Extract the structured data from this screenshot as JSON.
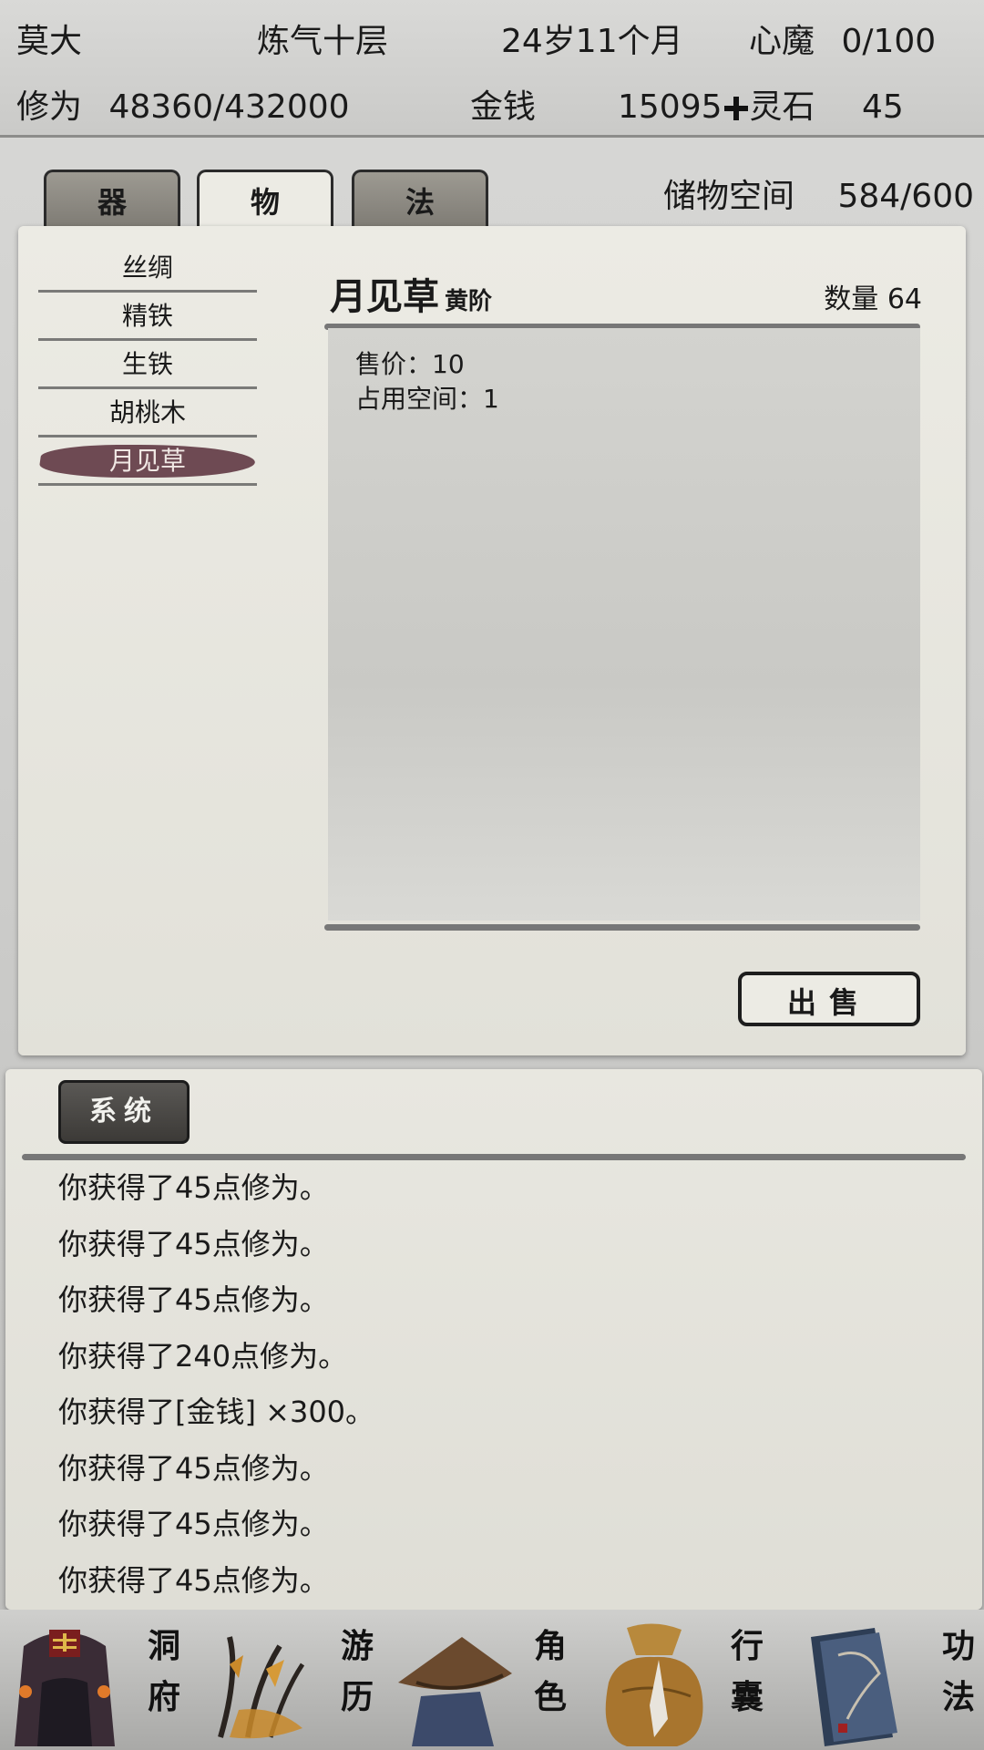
{
  "status": {
    "name": "莫大",
    "realm": "炼气十层",
    "age": "24岁11个月",
    "demon_label": "心魔",
    "demon_value": "0/100",
    "cultivation_label": "修为",
    "cultivation_value": "48360/432000",
    "money_label": "金钱",
    "money_value": "15095",
    "spirit_stone_label": "灵石",
    "spirit_stone_value": "45"
  },
  "tabs": [
    {
      "label": "器",
      "active": false
    },
    {
      "label": "物",
      "active": true
    },
    {
      "label": "法",
      "active": false
    }
  ],
  "storage": {
    "label": "储物空间",
    "value": "584/600"
  },
  "items": [
    {
      "label": "丝绸"
    },
    {
      "label": "精铁"
    },
    {
      "label": "生铁"
    },
    {
      "label": "胡桃木"
    },
    {
      "label": "月见草",
      "selected": true
    }
  ],
  "detail": {
    "name": "月见草",
    "grade": "黄阶",
    "quantity": "数量 64",
    "price": "售价：10",
    "space": "占用空间：1"
  },
  "sell_label": "出售",
  "log": {
    "tab_label": "系统",
    "lines": [
      "你获得了45点修为。",
      "你获得了45点修为。",
      "你获得了45点修为。",
      "你获得了240点修为。",
      "你获得了[金钱] ×300。",
      "你获得了45点修为。",
      "你获得了45点修为。",
      "你获得了45点修为。"
    ]
  },
  "nav": [
    {
      "label_1": "洞",
      "label_2": "府",
      "icon": "cave-mansion-icon"
    },
    {
      "label_1": "游",
      "label_2": "历",
      "icon": "travel-icon"
    },
    {
      "label_1": "角",
      "label_2": "色",
      "icon": "character-icon"
    },
    {
      "label_1": "行",
      "label_2": "囊",
      "icon": "inventory-bag-icon"
    },
    {
      "label_1": "功",
      "label_2": "法",
      "icon": "technique-books-icon"
    }
  ],
  "colors": {
    "selected_item": "#6e4a53",
    "log_tab": "#3c3a37"
  }
}
